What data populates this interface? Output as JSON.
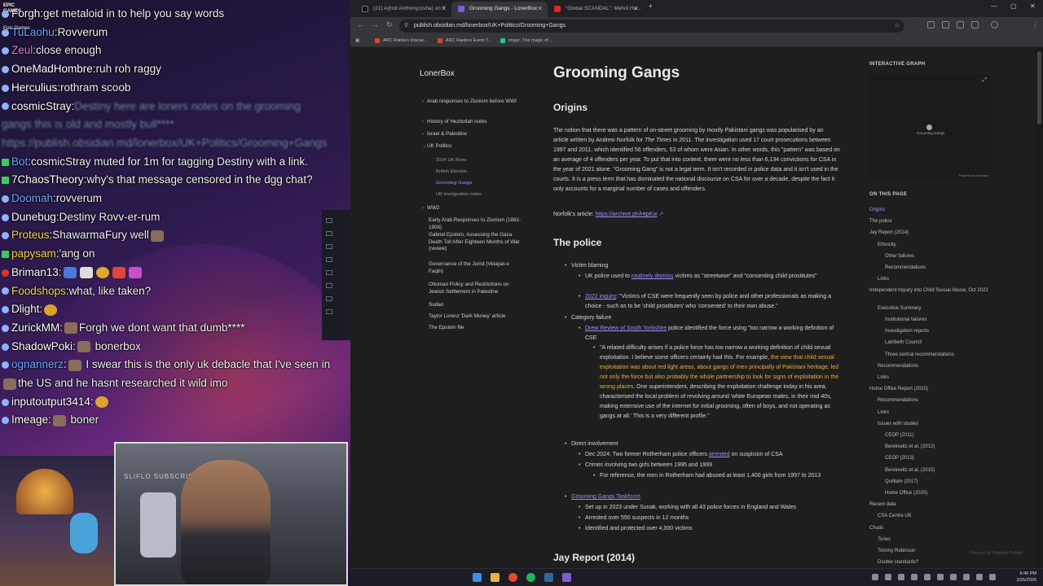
{
  "stream": {
    "brand_lines": [
      "EPIC",
      "GAMES"
    ],
    "brand_sub": "Epic Games",
    "webcam_sign": "SLIFLO SUBSCRIB",
    "chat": [
      {
        "user": "Forgh",
        "msg": "get metaloid in to help you say words"
      },
      {
        "user": "TuLaohu",
        "msg": "Rovverum"
      },
      {
        "user": "Zeul",
        "msg": "close enough"
      },
      {
        "user": "OneMadHombre",
        "msg": "ruh roh raggy"
      },
      {
        "user": "Herculius",
        "msg": "rothram scoob"
      },
      {
        "user": "cosmicStray",
        "msg": "Destiny here are loners notes on the grooming"
      },
      {
        "user": "",
        "msg": "gangs this is old and mostly bull****"
      },
      {
        "user": "",
        "msg": "https://publish.obsidian.md/lonerbox/UK+Politics/Grooming+Gangs"
      },
      {
        "user": "Bot",
        "msg": "cosmicStray muted for 1m for tagging Destiny with a link."
      },
      {
        "user": "7ChaosTheory",
        "msg": "why's that message censored in the dgg chat?"
      },
      {
        "user": "Doomah",
        "msg": "rovverum"
      },
      {
        "user": "Dunebug",
        "msg": "Destiny Rovv-er-rum"
      },
      {
        "user": "Proteus",
        "msg": "ShawarmaFury well"
      },
      {
        "user": "papysam",
        "msg": "'ang on"
      },
      {
        "user": "Briman13",
        "msg": ""
      },
      {
        "user": "Foodshops",
        "msg": "what, like taken?"
      },
      {
        "user": "Dlight",
        "msg": ""
      },
      {
        "user": "ZurickMM",
        "msg": "Forgh  we dont want that dumb****"
      },
      {
        "user": "ShadowPoki",
        "msg": " bonerbox"
      },
      {
        "user": "ognannerz",
        "msg": " I swear this is the only uk debacle that I've seen in"
      },
      {
        "user": "",
        "msg": "the US and he hasnt researched it  wild imo"
      },
      {
        "user": "inputoutput3414",
        "msg": ""
      },
      {
        "user": "Imeage",
        "msg": " boner"
      }
    ]
  },
  "browser": {
    "tabs": [
      {
        "label": "(21) A(lnot Anthony(osha) on X",
        "active": false
      },
      {
        "label": "Grooming Gangs - LonerBox",
        "active": true
      },
      {
        "label": "\"Global SCANDAL\": Mehdi Ha...",
        "active": false
      }
    ],
    "new_tab": "+",
    "url": "publish.obsidian.md/lonerbox/UK+Politics/Grooming+Gangs",
    "bookmarks": [
      "ARC Raiders Interac...",
      "ARC Raiders Event T...",
      "Imgur: The magic of..."
    ],
    "accent_color": "#a88bfa"
  },
  "site": {
    "title": "LonerBox",
    "nav": [
      {
        "label": "Arab responses to Zionism before WWI",
        "kind": "folder"
      },
      {
        "label": "History of Hezbollah notes",
        "kind": "folder"
      },
      {
        "label": "Israel & Palestine",
        "kind": "folder"
      },
      {
        "label": "UK Politics",
        "kind": "folder-open"
      },
      {
        "label": "2024 UK Riots",
        "kind": "sub"
      },
      {
        "label": "British Election",
        "kind": "sub"
      },
      {
        "label": "Grooming Gangs",
        "kind": "active"
      },
      {
        "label": "UK Immigration notes",
        "kind": "sub"
      },
      {
        "label": "WW2",
        "kind": "folder"
      },
      {
        "label": "Early Arab Responses to Zionism (1882-1908)",
        "kind": "page"
      },
      {
        "label": "Gabriel Epstein, Assessing the Gaza Death Toll After Eighteen Months of War (review)",
        "kind": "page"
      },
      {
        "label": "Governance of the Jurist (Velayat-e Faqih)",
        "kind": "page"
      },
      {
        "label": "Ottoman Policy and Restrictions on Jewish Settlement in Palestine",
        "kind": "page"
      },
      {
        "label": "Sudan",
        "kind": "page"
      },
      {
        "label": "Taylor Lorenz 'Dark Money' article",
        "kind": "page"
      },
      {
        "label": "The Epstein file",
        "kind": "page"
      }
    ]
  },
  "article": {
    "title": "Grooming Gangs",
    "origins_heading": "Origins",
    "origins_p1a": "The notion that there was a pattern of on-street grooming by mostly Pakistani gangs was popularised by an article written by Andrew Norfolk for ",
    "origins_p1_italic": "The Times",
    "origins_p1b": " in 2011. The investigation used 17 court prosecutions between 1997 and 2011, which identified 56 offenders, 53 of whom were Asian. In other words, this \"pattern\" was based on an average of 4 offenders per year. To put that into context, there were no less than 6,134 convictions for CSA in the year of 2021 alone. \"Grooming Gang\" is not a legal term. It isn't recorded in police data and it isn't used in the courts. It is a press term that has dominated the national discourse on CSA for over a decade, despite the fact it only accounts for a marginal number of cases and offenders.",
    "norfolk_label": "Norfolk's article: ",
    "norfolk_link": "https://archive.ph/HtpKw",
    "police_heading": "The police",
    "victim_blaming": "Victim blaming",
    "vb1a": "UK police used to ",
    "vb1_link": "routinely dismiss",
    "vb1b": " victims as \"streetwise\" and \"consenting child prostitutes\"",
    "vb2_link": "2022 inquiry",
    "vb2b": ": \"Victims of CSE were frequently seen by police and other professionals as making a choice - such as to be 'child prostitutes' who 'consented' to their own abuse.\"",
    "category_failure": "Category failure",
    "cf_link": "Drew Review of South Yorkshire",
    "cf_b": " police identified the force using \"too narrow a working definition of CSE",
    "quote_a": "\"A related difficulty arises if a police force has too narrow a working definition of child sexual exploitation. I believe some officers certainly had this. For example, ",
    "quote_hl": "the view that child sexual exploitation was about red light areas, about gangs of men principally of Pakistani heritage, led not only the force but also probably the whole partnership to look for signs of exploitation in the wrong places.",
    "quote_b": " One superintendent, describing the exploitation challenge today in his area, characterised the local problem of revolving around 'white European males, in their mid 40s, making extensive use of the internet for initial grooming, often of boys, and not operating as gangs at all.' This is a very different profile.\"",
    "direct_involvement": "Direct involvement",
    "di1a": "Dec 2024: Two former Rotherham police officers ",
    "di1_link": "arrested",
    "di1b": " on suspicion of CSA",
    "di2": "Crimes involving two girls between 1995 and 1999",
    "di3": "For reference, the men in Rotherham had abused at least 1,400 girls from 1997 to 2013",
    "taskforce_link": "Grooming Gangs Taskforce",
    "tf1": "Set up in 2023 under Sunak, working with all 43 police forces in England and Wales",
    "tf2": "Arrested over 550 suspects in 12 months",
    "tf3": "Identified and protected over 4,000 victims",
    "jay_heading": "Jay Report (2014)"
  },
  "sidebar_right": {
    "graph_title": "INTERACTIVE GRAPH",
    "graph_node": "Grooming Gangs",
    "graph_powered": "Powered by Obsidian",
    "toc_title": "ON THIS PAGE",
    "toc": [
      {
        "label": "Origins",
        "level": 1,
        "active": true
      },
      {
        "label": "The police",
        "level": 1
      },
      {
        "label": "Jay Report (2014)",
        "level": 1
      },
      {
        "label": "Ethnicity",
        "level": 2
      },
      {
        "label": "Other failures",
        "level": 3
      },
      {
        "label": "Recommendations",
        "level": 3
      },
      {
        "label": "Links",
        "level": 2
      },
      {
        "label": "Independent Inquiry into Child Sexual Abuse, Oct 2022",
        "level": 1
      },
      {
        "label": "Executive Summary",
        "level": 2
      },
      {
        "label": "Institutional failures",
        "level": 3
      },
      {
        "label": "Investigation reports",
        "level": 3
      },
      {
        "label": "Lambeth Council",
        "level": 3
      },
      {
        "label": "Three central recommendations",
        "level": 3
      },
      {
        "label": "Recommendations",
        "level": 2
      },
      {
        "label": "Links",
        "level": 2
      },
      {
        "label": "Home Office Report (2020)",
        "level": 1
      },
      {
        "label": "Recommendations",
        "level": 2
      },
      {
        "label": "Links",
        "level": 2
      },
      {
        "label": "Issues with studies",
        "level": 2
      },
      {
        "label": "CEOP (2011)",
        "level": 3
      },
      {
        "label": "Berelowitz et al. (2012)",
        "level": 3
      },
      {
        "label": "CEOP (2013)",
        "level": 3
      },
      {
        "label": "Berelowitz et al. (2015)",
        "level": 3
      },
      {
        "label": "Quilliam (2017)",
        "level": 3
      },
      {
        "label": "Home Office (2020)",
        "level": 3
      },
      {
        "label": "Recent data",
        "level": 1
      },
      {
        "label": "CSA Centre UK",
        "level": 2
      },
      {
        "label": "Chuds",
        "level": 1
      },
      {
        "label": "Tories",
        "level": 2
      },
      {
        "label": "Tommy Robinson",
        "level": 2
      },
      {
        "label": "Double standards?",
        "level": 2
      }
    ],
    "powered_by": "Powered by Obsidian Publish"
  },
  "taskbar": {
    "time": "6:46 PM",
    "date": "2/25/2026"
  }
}
